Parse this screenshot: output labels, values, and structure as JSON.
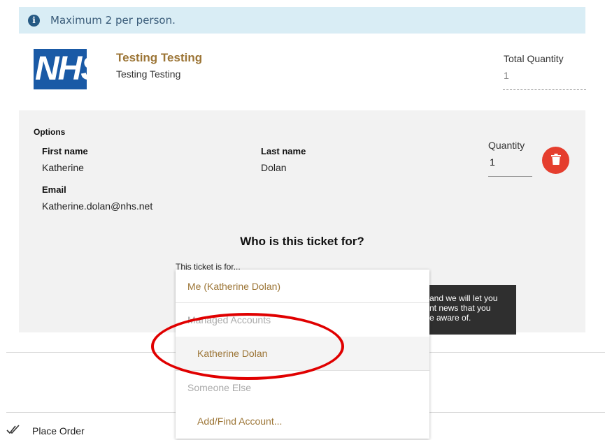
{
  "alert": {
    "icon": "info-icon",
    "text": "Maximum 2 per person."
  },
  "logo": {
    "text": "NHS",
    "color": "#1a5aa6"
  },
  "product": {
    "title": "Testing Testing",
    "subtitle": "Testing Testing"
  },
  "total": {
    "label": "Total Quantity",
    "value": "1"
  },
  "options": {
    "title": "Options",
    "first_name_label": "First name",
    "first_name": "Katherine",
    "last_name_label": "Last name",
    "last_name": "Dolan",
    "email_label": "Email",
    "email": "Katherine.dolan@nhs.net",
    "quantity_label": "Quantity",
    "quantity": "1",
    "delete_icon": "trash-icon"
  },
  "ticket": {
    "question": "Who is this ticket for?",
    "for_label": "This ticket is for..."
  },
  "dropdown": {
    "items": [
      {
        "label": "Me (Katherine Dolan)",
        "type": "option"
      },
      {
        "label": "Managed Accounts",
        "type": "header"
      },
      {
        "label": "Katherine Dolan",
        "type": "option"
      },
      {
        "label": "Someone Else",
        "type": "header"
      },
      {
        "label": "Add/Find Account...",
        "type": "option"
      }
    ]
  },
  "tooltip": {
    "lines": [
      "and we will let you",
      "nt news that you",
      "e aware of."
    ]
  },
  "footer": {
    "place_order": "Place Order",
    "icon": "double-check-icon"
  },
  "colors": {
    "accent": "#9c7536",
    "alert_bg": "#d9edf5",
    "delete": "#e53e2e",
    "highlight_ring": "#e00000"
  }
}
